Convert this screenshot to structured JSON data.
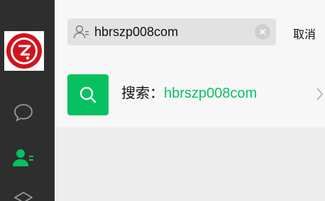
{
  "search": {
    "value": "hbrszp008com"
  },
  "cancel_label": "取消",
  "result": {
    "prefix": "搜索：",
    "term": "hbrszp008com"
  },
  "sidebar": {
    "icons": [
      "chat-icon",
      "contacts-icon",
      "favorites-icon"
    ]
  },
  "colors": {
    "accent": "#07c160",
    "sidebar_bg": "#2e2e2e",
    "logo_red": "#d0141c"
  }
}
